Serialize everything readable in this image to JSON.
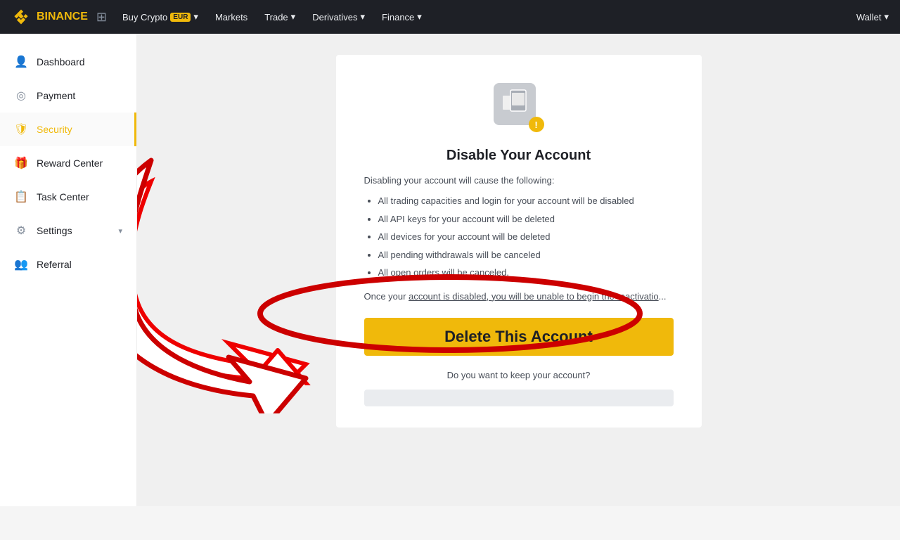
{
  "topnav": {
    "logo_text": "BINANCE",
    "buy_crypto": "Buy Crypto",
    "badge_eur": "EUR",
    "markets": "Markets",
    "trade": "Trade",
    "derivatives": "Derivatives",
    "finance": "Finance",
    "wallet": "Wallet"
  },
  "sidebar": {
    "items": [
      {
        "id": "dashboard",
        "label": "Dashboard",
        "icon": "👤",
        "active": false
      },
      {
        "id": "payment",
        "label": "Payment",
        "icon": "💲",
        "active": false
      },
      {
        "id": "security",
        "label": "Security",
        "icon": "🛡",
        "active": true
      },
      {
        "id": "reward-center",
        "label": "Reward Center",
        "icon": "🎁",
        "active": false
      },
      {
        "id": "task-center",
        "label": "Task Center",
        "icon": "📋",
        "active": false
      },
      {
        "id": "settings",
        "label": "Settings",
        "icon": "⚙",
        "active": false,
        "has_caret": true
      },
      {
        "id": "referral",
        "label": "Referral",
        "icon": "👥",
        "active": false
      }
    ]
  },
  "card": {
    "title": "Disable Your Account",
    "subtitle": "Disabling your account will cause the following:",
    "bullets": [
      "All trading capacities and login for your account will be disabled",
      "All API keys for your account will be deleted",
      "All devices for your account will be deleted",
      "All pending withdrawals will be canceled",
      "All open orders will be canceled."
    ],
    "note": "Once your account is disabled, you will be unable to begin the reactivatio...",
    "delete_button": "Delete This Account",
    "question": "Do you want to keep your account?",
    "cancel_label": ""
  }
}
